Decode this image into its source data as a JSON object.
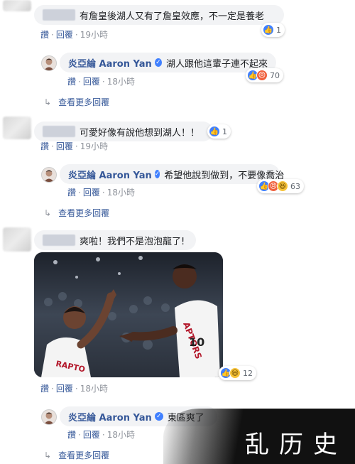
{
  "comments": [
    {
      "text": "有詹皇後湖人又有了詹皇效應，不一定是養老",
      "actions": [
        "讚",
        "回覆"
      ],
      "time": "19小時",
      "reaction_count": "1",
      "reactions": [
        "like-icon"
      ],
      "reply": {
        "author": "炎亞綸 Aaron Yan",
        "text": "湖人跟他這輩子連不起來",
        "actions": [
          "讚",
          "回覆"
        ],
        "time": "18小時",
        "reaction_count": "70",
        "reactions": [
          "like-icon",
          "angry-icon"
        ]
      },
      "more_replies": "查看更多回覆"
    },
    {
      "text": "可愛好像有說他想到湖人！！",
      "actions": [
        "讚",
        "回覆"
      ],
      "time": "19小時",
      "reaction_count": "1",
      "reactions": [
        "like-icon"
      ],
      "reply": {
        "author": "炎亞綸 Aaron Yan",
        "text": "希望他說到做到，不要像喬治",
        "actions": [
          "讚",
          "回覆"
        ],
        "time": "18小時",
        "reaction_count": "63",
        "reactions": [
          "like-icon",
          "angry-icon",
          "haha-icon"
        ]
      },
      "more_replies": "查看更多回覆"
    },
    {
      "text": "爽啦！我們不是泡泡龍了!",
      "actions": [
        "讚",
        "回覆"
      ],
      "time": "18小時",
      "reaction_count": "12",
      "reactions": [
        "like-icon",
        "haha-icon"
      ],
      "photo": {
        "jersey_left": "RAPTO",
        "jersey_right": "APTORS",
        "jersey_number": "10"
      },
      "reply": {
        "author": "炎亞綸 Aaron Yan",
        "text": "東區爽了",
        "actions": [
          "讚",
          "回覆"
        ],
        "time": "18小時"
      },
      "more_replies": "查看更多回覆"
    }
  ],
  "watermark": "乱历史",
  "colors": {
    "link": "#365899",
    "bubble": "#f2f3f5",
    "like": "#4080ff",
    "angry": "#f0603c",
    "haha": "#f7c33a"
  }
}
